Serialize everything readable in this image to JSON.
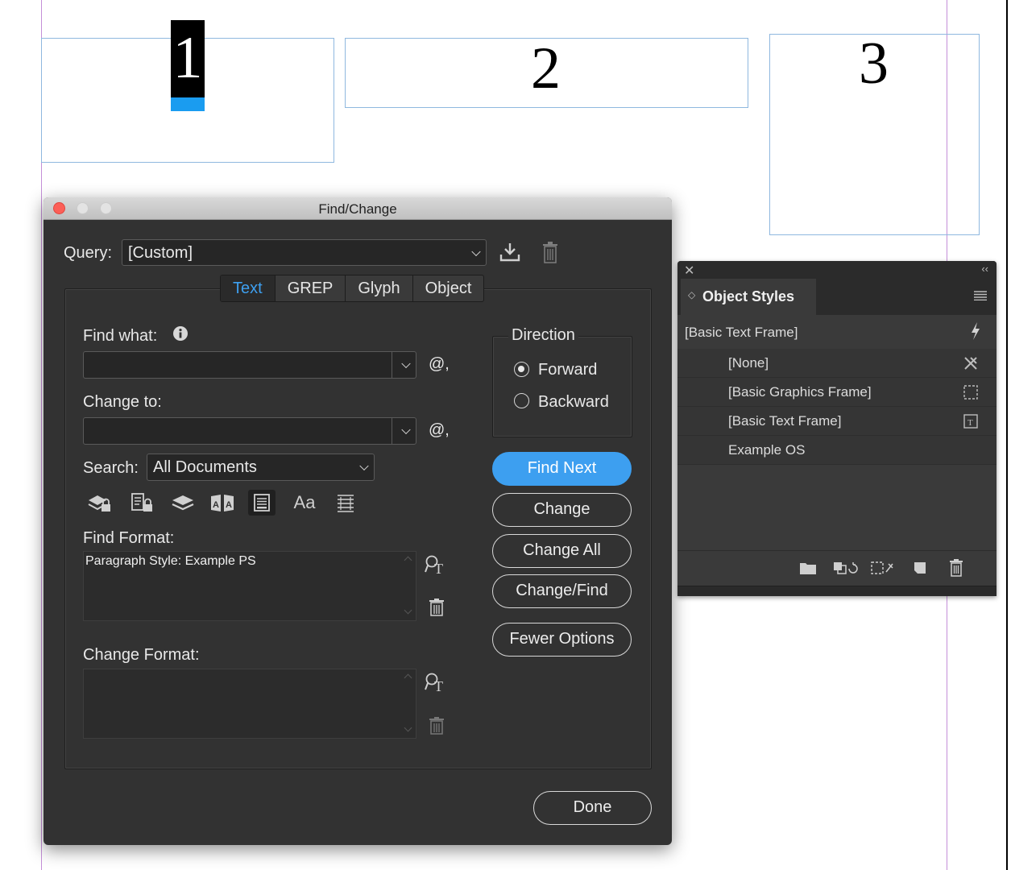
{
  "canvas": {
    "frames": [
      {
        "number": "1"
      },
      {
        "number": "2"
      },
      {
        "number": "3"
      }
    ]
  },
  "dialog": {
    "title": "Find/Change",
    "query": {
      "label": "Query:",
      "value": "[Custom]"
    },
    "tabs": [
      "Text",
      "GREP",
      "Glyph",
      "Object"
    ],
    "active_tab": "Text",
    "find_what": {
      "label": "Find what:",
      "value": ""
    },
    "change_to": {
      "label": "Change to:",
      "value": ""
    },
    "special_char": "@,",
    "search": {
      "label": "Search:",
      "value": "All Documents"
    },
    "option_case_label": "Aa",
    "find_format": {
      "label": "Find Format:",
      "value": "Paragraph Style: Example PS"
    },
    "change_format": {
      "label": "Change Format:",
      "value": ""
    },
    "direction": {
      "label": "Direction",
      "forward": "Forward",
      "backward": "Backward",
      "selected": "Forward"
    },
    "buttons": {
      "find_next": "Find Next",
      "change": "Change",
      "change_all": "Change All",
      "change_find": "Change/Find",
      "fewer_options": "Fewer Options",
      "done": "Done"
    },
    "colors": {
      "accent": "#3d9ff0",
      "close": "#fc5f57"
    }
  },
  "object_styles": {
    "title": "Object Styles",
    "current": "[Basic Text Frame]",
    "items": [
      {
        "label": "[None]"
      },
      {
        "label": "[Basic Graphics Frame]"
      },
      {
        "label": "[Basic Text Frame]"
      },
      {
        "label": "Example OS"
      }
    ]
  }
}
